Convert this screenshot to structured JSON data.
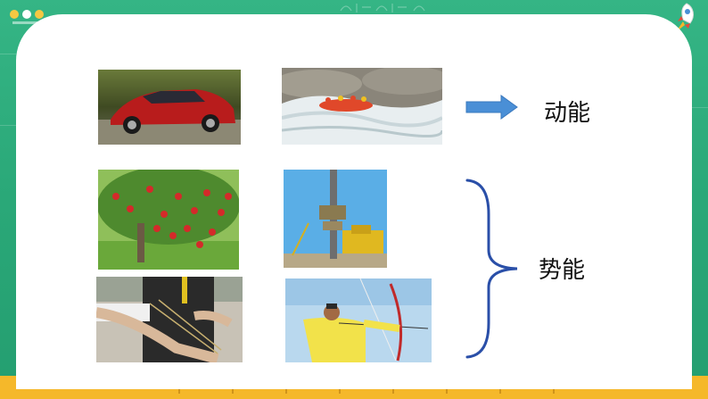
{
  "slide": {
    "kinetic_label": "动能",
    "potential_label": "势能"
  },
  "colors": {
    "board_green": "#2aa878",
    "card_white": "#ffffff",
    "arrow_fill": "#4a8fd6",
    "brace_color": "#2a4fa8",
    "bottom_strip": "#f5b82a"
  },
  "photos": [
    {
      "name": "red-car-photo"
    },
    {
      "name": "river-rafting-photo"
    },
    {
      "name": "apple-tree-photo"
    },
    {
      "name": "pile-driver-photo"
    },
    {
      "name": "slingshot-photo"
    },
    {
      "name": "archer-photo"
    }
  ]
}
